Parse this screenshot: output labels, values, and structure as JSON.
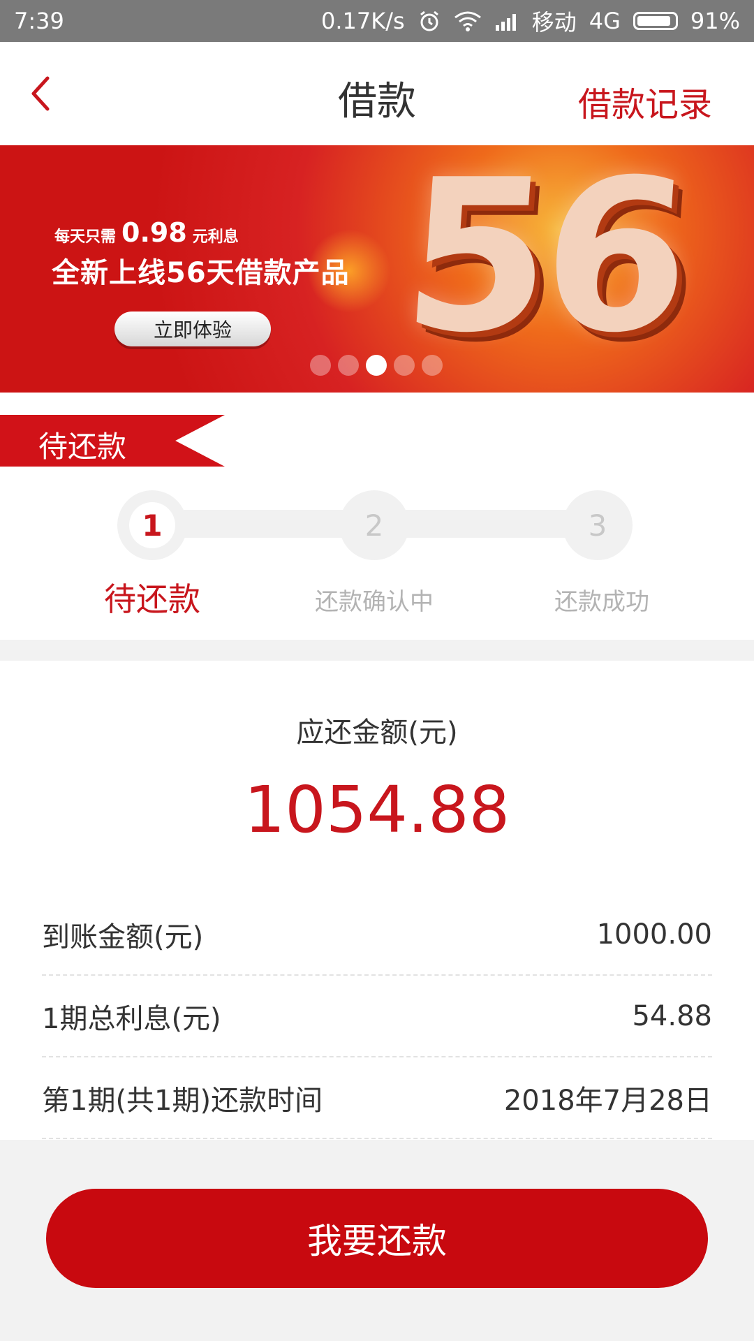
{
  "status_bar": {
    "time": "7:39",
    "net_speed": "0.17K/s",
    "carrier": "移动",
    "network": "4G",
    "battery": "91%",
    "battery_level": 0.91,
    "icons": [
      "alarm-icon",
      "wifi-icon",
      "signal-icon",
      "battery-icon"
    ]
  },
  "header": {
    "title": "借款",
    "action_label": "借款记录",
    "back_icon": "chevron-left-icon"
  },
  "banner": {
    "sub_prefix": "每天只需",
    "sub_amount": "0.98",
    "sub_suffix": "元利息",
    "title": "全新上线56天借款产品",
    "button_label": "立即体验",
    "big_number": "56",
    "dots_total": 5,
    "dots_active_index": 2
  },
  "section_ribbon": "待还款",
  "steps": [
    {
      "num": "1",
      "label": "待还款",
      "active": true
    },
    {
      "num": "2",
      "label": "还款确认中",
      "active": false
    },
    {
      "num": "3",
      "label": "还款成功",
      "active": false
    }
  ],
  "amount": {
    "label": "应还金额(元)",
    "value": "1054.88"
  },
  "details": [
    {
      "label": "到账金额(元)",
      "value": "1000.00"
    },
    {
      "label": "1期总利息(元)",
      "value": "54.88"
    },
    {
      "label": "第1期(共1期)还款时间",
      "value": "2018年7月28日"
    }
  ],
  "primary_button": "我要还款",
  "colors": {
    "accent": "#c8161d",
    "button": "#c8090f",
    "banner": "#cc1414"
  }
}
